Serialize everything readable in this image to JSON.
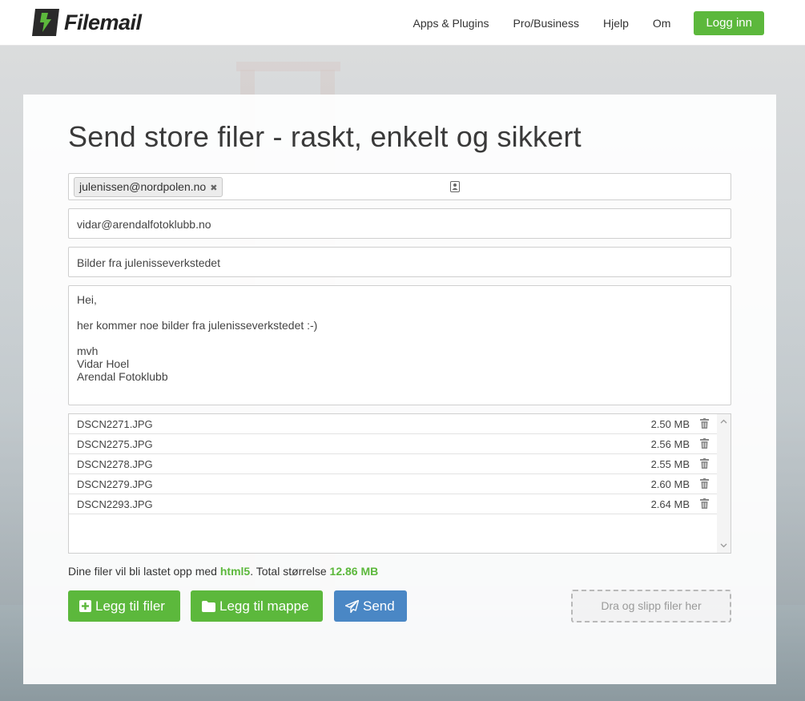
{
  "header": {
    "logo_text": "Filemail",
    "nav": [
      "Apps & Plugins",
      "Pro/Business",
      "Hjelp",
      "Om"
    ],
    "login_label": "Logg inn"
  },
  "form": {
    "title": "Send store filer - raskt, enkelt og sikkert",
    "recipient_chip": "julenissen@nordpolen.no",
    "chip_remove": "✖",
    "from_value": "vidar@arendalfotoklubb.no",
    "subject_value": "Bilder fra julenisseverkstedet",
    "message_lines": [
      "Hei,",
      "",
      "her kommer noe bilder fra julenisseverkstedet :-)",
      "",
      "mvh",
      "Vidar Hoel",
      "Arendal Fotoklubb"
    ]
  },
  "files": [
    {
      "name": "DSCN2271.JPG",
      "size": "2.50 MB"
    },
    {
      "name": "DSCN2275.JPG",
      "size": "2.56 MB"
    },
    {
      "name": "DSCN2278.JPG",
      "size": "2.55 MB"
    },
    {
      "name": "DSCN2279.JPG",
      "size": "2.60 MB"
    },
    {
      "name": "DSCN2293.JPG",
      "size": "2.64 MB"
    }
  ],
  "upload_info": {
    "prefix": "Dine filer vil bli lastet opp med ",
    "method": "html5",
    "middle": ". Total størrelse ",
    "total": "12.86 MB"
  },
  "actions": {
    "add_files": "Legg til filer",
    "add_folder": "Legg til mappe",
    "send": "Send",
    "dropzone": "Dra og slipp filer her"
  },
  "colors": {
    "brand_green": "#5cb83c",
    "send_blue": "#4a87c5"
  },
  "icons": {
    "chip_remove": "close-icon",
    "contacts": "address-book-icon",
    "file_delete": "trash-icon",
    "add_files": "plus-square-icon",
    "add_folder": "folder-icon",
    "send": "paper-plane-icon"
  }
}
